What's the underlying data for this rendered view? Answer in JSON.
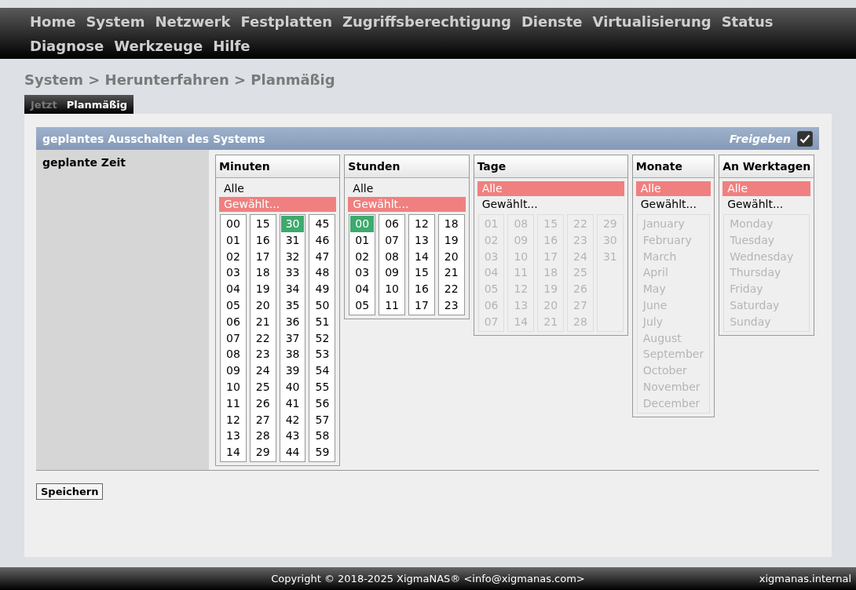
{
  "menu": [
    {
      "label": "Home"
    },
    {
      "label": "System"
    },
    {
      "label": "Netzwerk"
    },
    {
      "label": "Festplatten"
    },
    {
      "label": "Zugriffsberechtigung"
    },
    {
      "label": "Dienste"
    },
    {
      "label": "Virtualisierung"
    },
    {
      "label": "Status"
    },
    {
      "label": "Diagnose"
    },
    {
      "label": "Werkzeuge"
    },
    {
      "label": "Hilfe"
    }
  ],
  "breadcrumb": "System > Herunterfahren > Planmäßig",
  "tabs": [
    {
      "label": "Jetzt",
      "selected": false
    },
    {
      "label": "Planmäßig",
      "selected": true
    }
  ],
  "section": {
    "title": "geplantes Ausschalten des Systems",
    "enable_label": "Freigeben",
    "enabled": true
  },
  "field_label": "geplante Zeit",
  "pickers": [
    {
      "title": "Minuten",
      "list_disabled": false,
      "modes": [
        {
          "label": "Alle",
          "selected": false
        },
        {
          "label": "Gewählt...",
          "selected": true
        }
      ],
      "columns": [
        [
          {
            "label": "00",
            "selected": false
          },
          {
            "label": "01",
            "selected": false
          },
          {
            "label": "02",
            "selected": false
          },
          {
            "label": "03",
            "selected": false
          },
          {
            "label": "04",
            "selected": false
          },
          {
            "label": "05",
            "selected": false
          },
          {
            "label": "06",
            "selected": false
          },
          {
            "label": "07",
            "selected": false
          },
          {
            "label": "08",
            "selected": false
          },
          {
            "label": "09",
            "selected": false
          },
          {
            "label": "10",
            "selected": false
          },
          {
            "label": "11",
            "selected": false
          },
          {
            "label": "12",
            "selected": false
          },
          {
            "label": "13",
            "selected": false
          },
          {
            "label": "14",
            "selected": false
          }
        ],
        [
          {
            "label": "15",
            "selected": false
          },
          {
            "label": "16",
            "selected": false
          },
          {
            "label": "17",
            "selected": false
          },
          {
            "label": "18",
            "selected": false
          },
          {
            "label": "19",
            "selected": false
          },
          {
            "label": "20",
            "selected": false
          },
          {
            "label": "21",
            "selected": false
          },
          {
            "label": "22",
            "selected": false
          },
          {
            "label": "23",
            "selected": false
          },
          {
            "label": "24",
            "selected": false
          },
          {
            "label": "25",
            "selected": false
          },
          {
            "label": "26",
            "selected": false
          },
          {
            "label": "27",
            "selected": false
          },
          {
            "label": "28",
            "selected": false
          },
          {
            "label": "29",
            "selected": false
          }
        ],
        [
          {
            "label": "30",
            "selected": true
          },
          {
            "label": "31",
            "selected": false
          },
          {
            "label": "32",
            "selected": false
          },
          {
            "label": "33",
            "selected": false
          },
          {
            "label": "34",
            "selected": false
          },
          {
            "label": "35",
            "selected": false
          },
          {
            "label": "36",
            "selected": false
          },
          {
            "label": "37",
            "selected": false
          },
          {
            "label": "38",
            "selected": false
          },
          {
            "label": "39",
            "selected": false
          },
          {
            "label": "40",
            "selected": false
          },
          {
            "label": "41",
            "selected": false
          },
          {
            "label": "42",
            "selected": false
          },
          {
            "label": "43",
            "selected": false
          },
          {
            "label": "44",
            "selected": false
          }
        ],
        [
          {
            "label": "45",
            "selected": false
          },
          {
            "label": "46",
            "selected": false
          },
          {
            "label": "47",
            "selected": false
          },
          {
            "label": "48",
            "selected": false
          },
          {
            "label": "49",
            "selected": false
          },
          {
            "label": "50",
            "selected": false
          },
          {
            "label": "51",
            "selected": false
          },
          {
            "label": "52",
            "selected": false
          },
          {
            "label": "53",
            "selected": false
          },
          {
            "label": "54",
            "selected": false
          },
          {
            "label": "55",
            "selected": false
          },
          {
            "label": "56",
            "selected": false
          },
          {
            "label": "57",
            "selected": false
          },
          {
            "label": "58",
            "selected": false
          },
          {
            "label": "59",
            "selected": false
          }
        ]
      ]
    },
    {
      "title": "Stunden",
      "list_disabled": false,
      "modes": [
        {
          "label": "Alle",
          "selected": false
        },
        {
          "label": "Gewählt...",
          "selected": true
        }
      ],
      "columns": [
        [
          {
            "label": "00",
            "selected": true
          },
          {
            "label": "01",
            "selected": false
          },
          {
            "label": "02",
            "selected": false
          },
          {
            "label": "03",
            "selected": false
          },
          {
            "label": "04",
            "selected": false
          },
          {
            "label": "05",
            "selected": false
          }
        ],
        [
          {
            "label": "06",
            "selected": false
          },
          {
            "label": "07",
            "selected": false
          },
          {
            "label": "08",
            "selected": false
          },
          {
            "label": "09",
            "selected": false
          },
          {
            "label": "10",
            "selected": false
          },
          {
            "label": "11",
            "selected": false
          }
        ],
        [
          {
            "label": "12",
            "selected": false
          },
          {
            "label": "13",
            "selected": false
          },
          {
            "label": "14",
            "selected": false
          },
          {
            "label": "15",
            "selected": false
          },
          {
            "label": "16",
            "selected": false
          },
          {
            "label": "17",
            "selected": false
          }
        ],
        [
          {
            "label": "18",
            "selected": false
          },
          {
            "label": "19",
            "selected": false
          },
          {
            "label": "20",
            "selected": false
          },
          {
            "label": "21",
            "selected": false
          },
          {
            "label": "22",
            "selected": false
          },
          {
            "label": "23",
            "selected": false
          }
        ]
      ]
    },
    {
      "title": "Tage",
      "list_disabled": true,
      "modes": [
        {
          "label": "Alle",
          "selected": true
        },
        {
          "label": "Gewählt...",
          "selected": false
        }
      ],
      "columns": [
        [
          {
            "label": "01",
            "selected": false
          },
          {
            "label": "02",
            "selected": false
          },
          {
            "label": "03",
            "selected": false
          },
          {
            "label": "04",
            "selected": false
          },
          {
            "label": "05",
            "selected": false
          },
          {
            "label": "06",
            "selected": false
          },
          {
            "label": "07",
            "selected": false
          }
        ],
        [
          {
            "label": "08",
            "selected": false
          },
          {
            "label": "09",
            "selected": false
          },
          {
            "label": "10",
            "selected": false
          },
          {
            "label": "11",
            "selected": false
          },
          {
            "label": "12",
            "selected": false
          },
          {
            "label": "13",
            "selected": false
          },
          {
            "label": "14",
            "selected": false
          }
        ],
        [
          {
            "label": "15",
            "selected": false
          },
          {
            "label": "16",
            "selected": false
          },
          {
            "label": "17",
            "selected": false
          },
          {
            "label": "18",
            "selected": false
          },
          {
            "label": "19",
            "selected": false
          },
          {
            "label": "20",
            "selected": false
          },
          {
            "label": "21",
            "selected": false
          }
        ],
        [
          {
            "label": "22",
            "selected": false
          },
          {
            "label": "23",
            "selected": false
          },
          {
            "label": "24",
            "selected": false
          },
          {
            "label": "25",
            "selected": false
          },
          {
            "label": "26",
            "selected": false
          },
          {
            "label": "27",
            "selected": false
          },
          {
            "label": "28",
            "selected": false
          }
        ],
        [
          {
            "label": "29",
            "selected": false
          },
          {
            "label": "30",
            "selected": false
          },
          {
            "label": "31",
            "selected": false
          }
        ]
      ]
    },
    {
      "title": "Monate",
      "list_disabled": true,
      "modes": [
        {
          "label": "Alle",
          "selected": true
        },
        {
          "label": "Gewählt...",
          "selected": false
        }
      ],
      "columns": [
        [
          {
            "label": "January",
            "selected": false
          },
          {
            "label": "February",
            "selected": false
          },
          {
            "label": "March",
            "selected": false
          },
          {
            "label": "April",
            "selected": false
          },
          {
            "label": "May",
            "selected": false
          },
          {
            "label": "June",
            "selected": false
          },
          {
            "label": "July",
            "selected": false
          },
          {
            "label": "August",
            "selected": false
          },
          {
            "label": "September",
            "selected": false
          },
          {
            "label": "October",
            "selected": false
          },
          {
            "label": "November",
            "selected": false
          },
          {
            "label": "December",
            "selected": false
          }
        ]
      ]
    },
    {
      "title": "An Werktagen",
      "list_disabled": true,
      "modes": [
        {
          "label": "Alle",
          "selected": true
        },
        {
          "label": "Gewählt...",
          "selected": false
        }
      ],
      "columns": [
        [
          {
            "label": "Monday",
            "selected": false
          },
          {
            "label": "Tuesday",
            "selected": false
          },
          {
            "label": "Wednesday",
            "selected": false
          },
          {
            "label": "Thursday",
            "selected": false
          },
          {
            "label": "Friday",
            "selected": false
          },
          {
            "label": "Saturday",
            "selected": false
          },
          {
            "label": "Sunday",
            "selected": false
          }
        ]
      ]
    }
  ],
  "save_button": "Speichern",
  "footer": {
    "copyright": "Copyright © 2018-2025 XigmaNAS® <info@xigmanas.com>",
    "host": "xigmanas.internal"
  }
}
